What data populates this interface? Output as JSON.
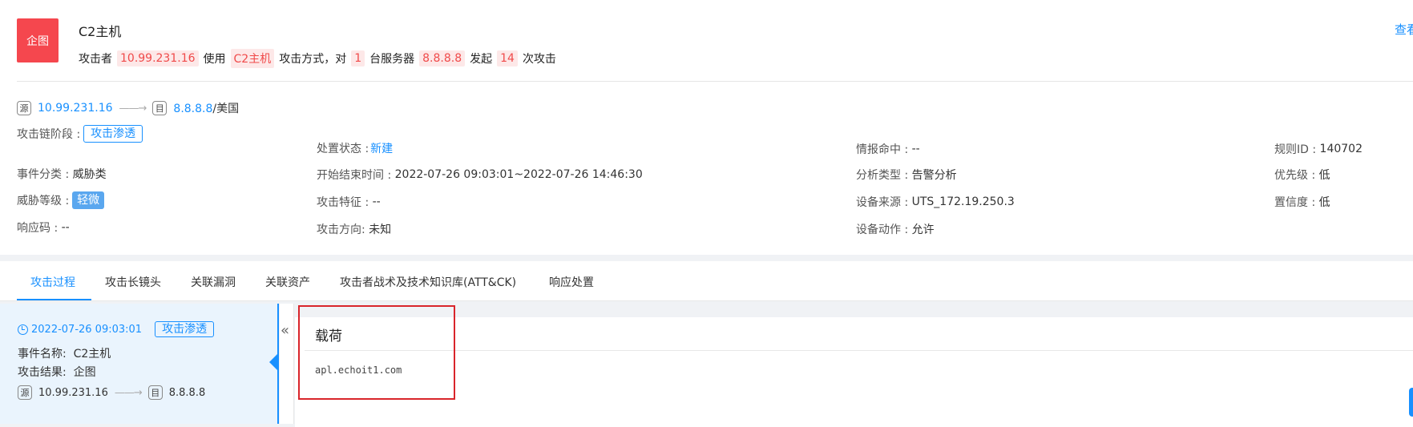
{
  "header": {
    "icon_text": "企图",
    "title": "C2主机",
    "view_link": "查看",
    "summary": {
      "p1": "攻击者",
      "attacker_ip": "10.99.231.16",
      "p2": "使用",
      "attack_type": "C2主机",
      "p3": "攻击方式，对",
      "server_count": "1",
      "p4": "台服务器",
      "target_ip": "8.8.8.8",
      "p5": "发起",
      "attack_count": "14",
      "p6": "次攻击"
    }
  },
  "flow": {
    "src_char": "源",
    "src_ip": "10.99.231.16",
    "arrow": "——→",
    "dst_char": "目",
    "dst_ip": "8.8.8.8",
    "dst_geo": "/美国"
  },
  "info": {
    "chain_stage_label": "攻击链阶段 :",
    "chain_stage_value": "攻击渗透",
    "event_category_label": "事件分类 :",
    "event_category_value": "威胁类",
    "threat_level_label": "威胁等级 :",
    "threat_level_value": "轻微",
    "response_code_label": "响应码 :",
    "response_code_value": "--",
    "disposal_label": "处置状态 :",
    "disposal_value": "新建",
    "time_label": "开始结束时间 :",
    "time_value": "2022-07-26 09:03:01~2022-07-26 14:46:30",
    "feature_label": "攻击特征 :",
    "feature_value": "--",
    "direction_label": "攻击方向:",
    "direction_value": "未知",
    "intel_label": "情报命中 :",
    "intel_value": "--",
    "analysis_label": "分析类型 :",
    "analysis_value": "告警分析",
    "device_source_label": "设备来源 :",
    "device_source_value": "UTS_172.19.250.3",
    "device_action_label": "设备动作 :",
    "device_action_value": "允许",
    "rule_id_label": "规则ID :",
    "rule_id_value": "140702",
    "priority_label": "优先级 :",
    "priority_value": "低",
    "confidence_label": "置信度 :",
    "confidence_value": "低"
  },
  "tabs": [
    {
      "label": "攻击过程"
    },
    {
      "label": "攻击长镜头"
    },
    {
      "label": "关联漏洞"
    },
    {
      "label": "关联资产"
    },
    {
      "label": "攻击者战术及技术知识库(ATT&CK)"
    },
    {
      "label": "响应处置"
    }
  ],
  "timeline": {
    "time": "2022-07-26 09:03:01",
    "stage": "攻击渗透",
    "event_name_label": "事件名称:",
    "event_name_value": "C2主机",
    "result_label": "攻击结果:",
    "result_value": "企图",
    "src_char": "源",
    "src_ip": "10.99.231.16",
    "arrow": "——→",
    "dst_char": "目",
    "dst_ip": "8.8.8.8"
  },
  "payload": {
    "collapse_glyph": "«",
    "title": "载荷",
    "content": "apl.echoit1.com"
  },
  "colors": {
    "accent": "#1890ff",
    "alert_red": "#f5474e",
    "highlight_bg": "#fde8e8",
    "selection_box": "#d9252b"
  }
}
